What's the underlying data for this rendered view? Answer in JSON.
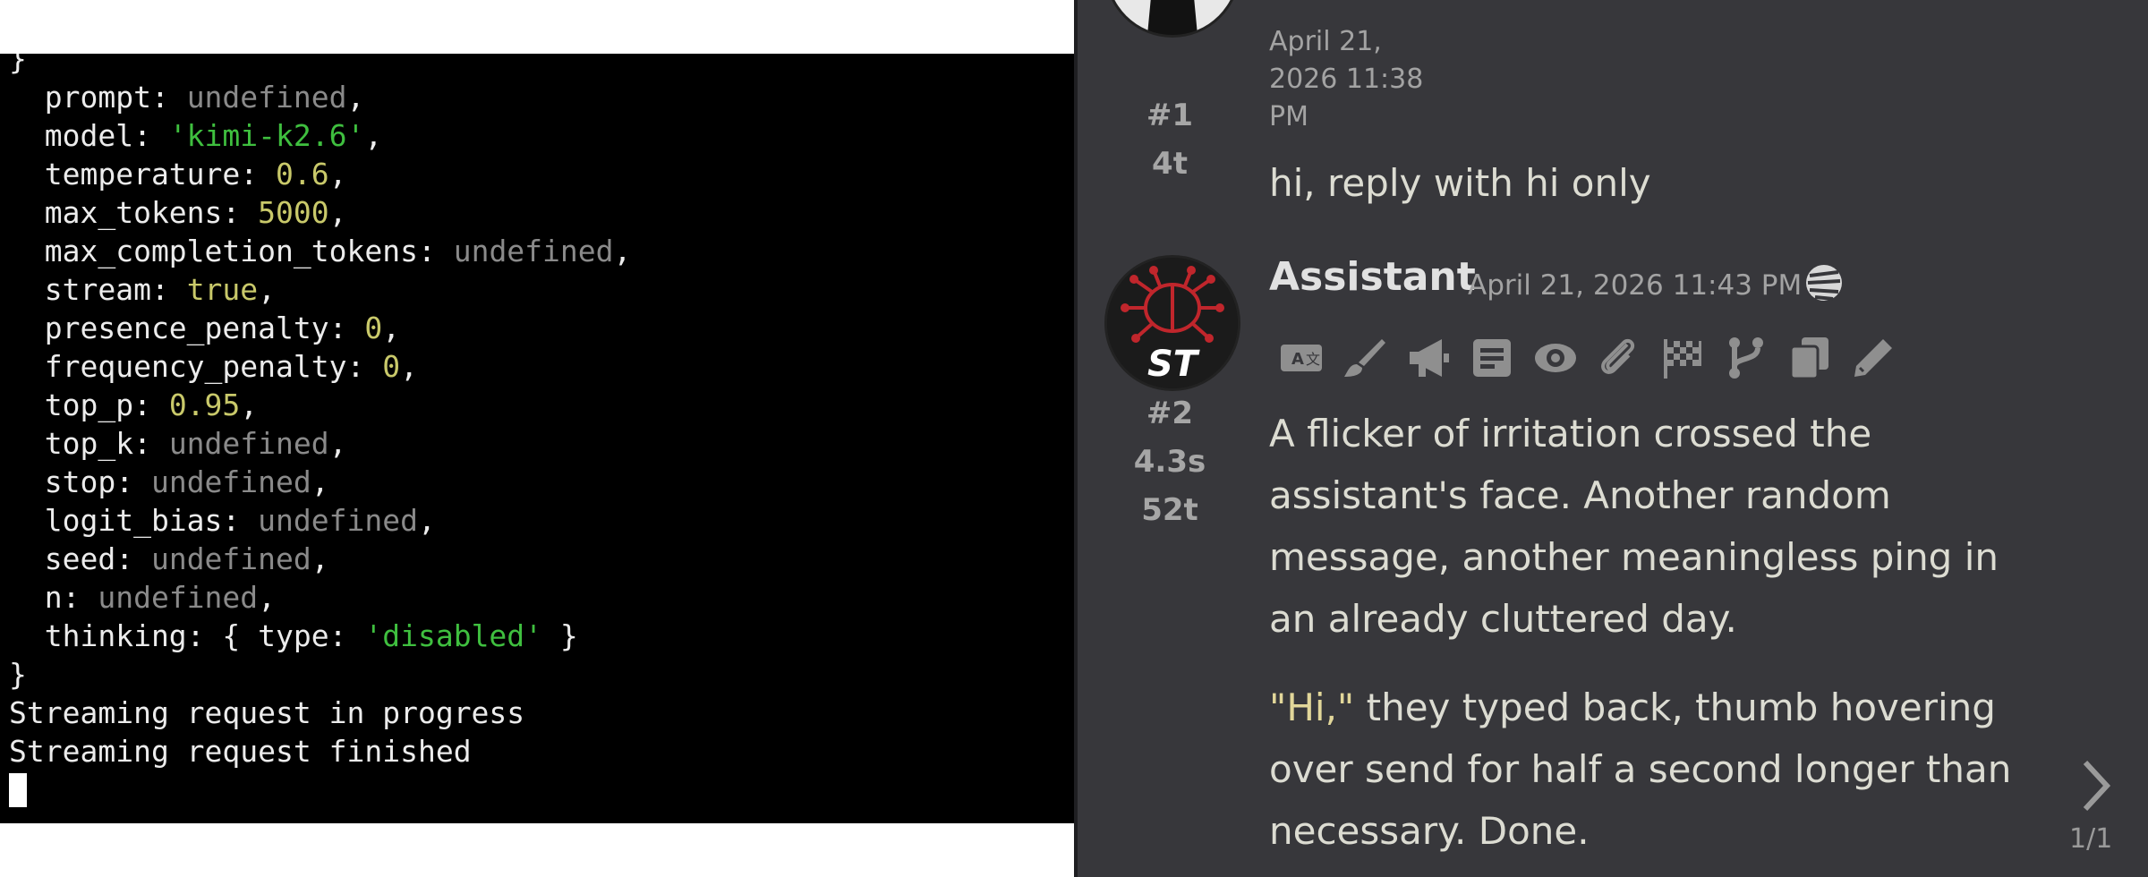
{
  "terminal": {
    "lines": [
      [
        {
          "t": "}",
          "c": "k"
        }
      ],
      [
        {
          "t": "  prompt: ",
          "c": "k"
        },
        {
          "t": "undefined",
          "c": "u"
        },
        {
          "t": ",",
          "c": "k"
        }
      ],
      [
        {
          "t": "  model: ",
          "c": "k"
        },
        {
          "t": "'kimi-k2.6'",
          "c": "s"
        },
        {
          "t": ",",
          "c": "k"
        }
      ],
      [
        {
          "t": "  temperature: ",
          "c": "k"
        },
        {
          "t": "0.6",
          "c": "n"
        },
        {
          "t": ",",
          "c": "k"
        }
      ],
      [
        {
          "t": "  max_tokens: ",
          "c": "k"
        },
        {
          "t": "5000",
          "c": "n"
        },
        {
          "t": ",",
          "c": "k"
        }
      ],
      [
        {
          "t": "  max_completion_tokens: ",
          "c": "k"
        },
        {
          "t": "undefined",
          "c": "u"
        },
        {
          "t": ",",
          "c": "k"
        }
      ],
      [
        {
          "t": "  stream: ",
          "c": "k"
        },
        {
          "t": "true",
          "c": "n"
        },
        {
          "t": ",",
          "c": "k"
        }
      ],
      [
        {
          "t": "  presence_penalty: ",
          "c": "k"
        },
        {
          "t": "0",
          "c": "n"
        },
        {
          "t": ",",
          "c": "k"
        }
      ],
      [
        {
          "t": "  frequency_penalty: ",
          "c": "k"
        },
        {
          "t": "0",
          "c": "n"
        },
        {
          "t": ",",
          "c": "k"
        }
      ],
      [
        {
          "t": "  top_p: ",
          "c": "k"
        },
        {
          "t": "0.95",
          "c": "n"
        },
        {
          "t": ",",
          "c": "k"
        }
      ],
      [
        {
          "t": "  top_k: ",
          "c": "k"
        },
        {
          "t": "undefined",
          "c": "u"
        },
        {
          "t": ",",
          "c": "k"
        }
      ],
      [
        {
          "t": "  stop: ",
          "c": "k"
        },
        {
          "t": "undefined",
          "c": "u"
        },
        {
          "t": ",",
          "c": "k"
        }
      ],
      [
        {
          "t": "  logit_bias: ",
          "c": "k"
        },
        {
          "t": "undefined",
          "c": "u"
        },
        {
          "t": ",",
          "c": "k"
        }
      ],
      [
        {
          "t": "  seed: ",
          "c": "k"
        },
        {
          "t": "undefined",
          "c": "u"
        },
        {
          "t": ",",
          "c": "k"
        }
      ],
      [
        {
          "t": "  n: ",
          "c": "k"
        },
        {
          "t": "undefined",
          "c": "u"
        },
        {
          "t": ",",
          "c": "k"
        }
      ],
      [
        {
          "t": "  thinking: { type: ",
          "c": "k"
        },
        {
          "t": "'disabled'",
          "c": "s"
        },
        {
          "t": " }",
          "c": "k"
        }
      ],
      [
        {
          "t": "}",
          "c": "k"
        }
      ],
      [
        {
          "t": "Streaming request in progress",
          "c": "k"
        }
      ],
      [
        {
          "t": "Streaming request finished",
          "c": "k"
        }
      ]
    ]
  },
  "chat": {
    "messages": [
      {
        "index_label": "#1",
        "tokens": "4t",
        "timestamp_lines": [
          "April 21,",
          "2026 11:38",
          "PM"
        ],
        "text": "hi, reply with hi only"
      },
      {
        "name": "Assistant",
        "timestamp": "April 21, 2026 11:43 PM",
        "avatar_text": "ST",
        "index_label": "#2",
        "duration": "4.3s",
        "tokens": "52t",
        "paragraphs": [
          {
            "lines": [
              "A flicker of irritation crossed the",
              "assistant's face. Another random",
              "message, another meaningless ping in",
              "an already cluttered day."
            ]
          },
          {
            "quote": "\"Hi,\"",
            "lines": [
              " they typed back, thumb hovering",
              "over send for half a second longer than",
              "necessary. Done."
            ]
          }
        ],
        "actions": [
          "translate-icon",
          "paintbrush-icon",
          "bullhorn-icon",
          "note-icon",
          "eye-icon",
          "paperclip-icon",
          "checkered-flag-icon",
          "branch-icon",
          "copy-icon",
          "pencil-icon"
        ]
      }
    ],
    "swipe": {
      "counter": "1/1",
      "icon": "chevron-right-icon"
    }
  },
  "colors": {
    "terminal_bg": "#000000",
    "terminal_text": "#ececec",
    "terminal_string": "#3fbf3f",
    "terminal_number": "#c9c96a",
    "terminal_undefined": "#8a8a8a",
    "chat_bg": "#37373b",
    "chat_text": "#dcdcd2",
    "chat_quote": "#e2d79a",
    "icon_gray": "#8f8f8f",
    "avatar_accent": "#c0262c"
  }
}
